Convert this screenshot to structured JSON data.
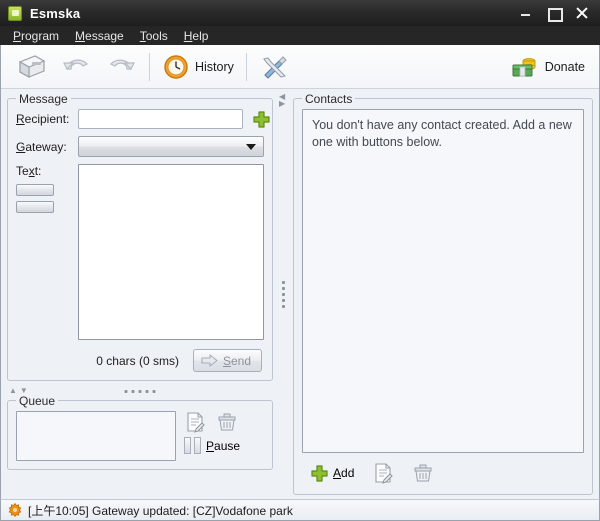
{
  "window": {
    "title": "Esmska",
    "app_icon": "phone-icon",
    "controls": [
      {
        "name": "minimize",
        "glyph": "minimize-icon"
      },
      {
        "name": "maximize",
        "glyph": "maximize-icon"
      },
      {
        "name": "close",
        "glyph": "close-icon"
      }
    ]
  },
  "menubar": {
    "items": [
      {
        "label": "Program",
        "mnemonic": "P"
      },
      {
        "label": "Message",
        "mnemonic": "M"
      },
      {
        "label": "Tools",
        "mnemonic": "T"
      },
      {
        "label": "Help",
        "mnemonic": "H"
      }
    ]
  },
  "toolbar": {
    "buttons": [
      {
        "name": "compose",
        "icon": "fax-printer-icon",
        "label": ""
      },
      {
        "name": "undo",
        "icon": "undo-arrow-icon",
        "label": ""
      },
      {
        "name": "redo",
        "icon": "redo-arrow-icon",
        "label": ""
      },
      {
        "name": "history",
        "icon": "clock-icon",
        "label": "History"
      },
      {
        "name": "config",
        "icon": "tools-icon",
        "label": ""
      },
      {
        "name": "donate",
        "icon": "money-icon",
        "label": "Donate"
      }
    ],
    "history_label": "History",
    "donate_label": "Donate"
  },
  "message_panel": {
    "legend": "Message",
    "recipient": {
      "label": "Recipient:",
      "mnemonic": "R",
      "value": "",
      "placeholder": ""
    },
    "add_contact_icon": "green-plus-icon",
    "gateway": {
      "label": "Gateway:",
      "mnemonic": "G",
      "selected": "",
      "options": []
    },
    "text": {
      "label": "Text:",
      "mnemonic": "x",
      "value": "",
      "placeholder": ""
    },
    "mini_buttons": [
      "",
      ""
    ],
    "char_count": "0 chars (0 sms)",
    "send": {
      "label": "Send",
      "mnemonic": "S",
      "icon": "send-arrow-icon",
      "disabled": true
    }
  },
  "queue_panel": {
    "legend": "Queue",
    "items": [],
    "edit_icon": "edit-document-icon",
    "delete_icon": "trash-icon",
    "pause": {
      "label": "Pause",
      "mnemonic": "P",
      "icon": "pause-icon"
    }
  },
  "contacts_panel": {
    "legend": "Contacts",
    "empty_message": "You don't have any contact created. Add a new one with buttons below.",
    "add": {
      "label": "Add",
      "mnemonic": "A",
      "icon": "green-plus-icon"
    },
    "edit_icon": "edit-document-icon",
    "delete_icon": "trash-icon"
  },
  "statusbar": {
    "icon": "gear-icon",
    "message": "[上午10:05] Gateway updated: [CZ]Vodafone park"
  },
  "colors": {
    "accent_green": "#8dbf2e",
    "titlebar": "#2a2a2a",
    "panel_bg": "#eef2f7",
    "border": "#bcc4cf",
    "status_icon": "#e8941a"
  }
}
